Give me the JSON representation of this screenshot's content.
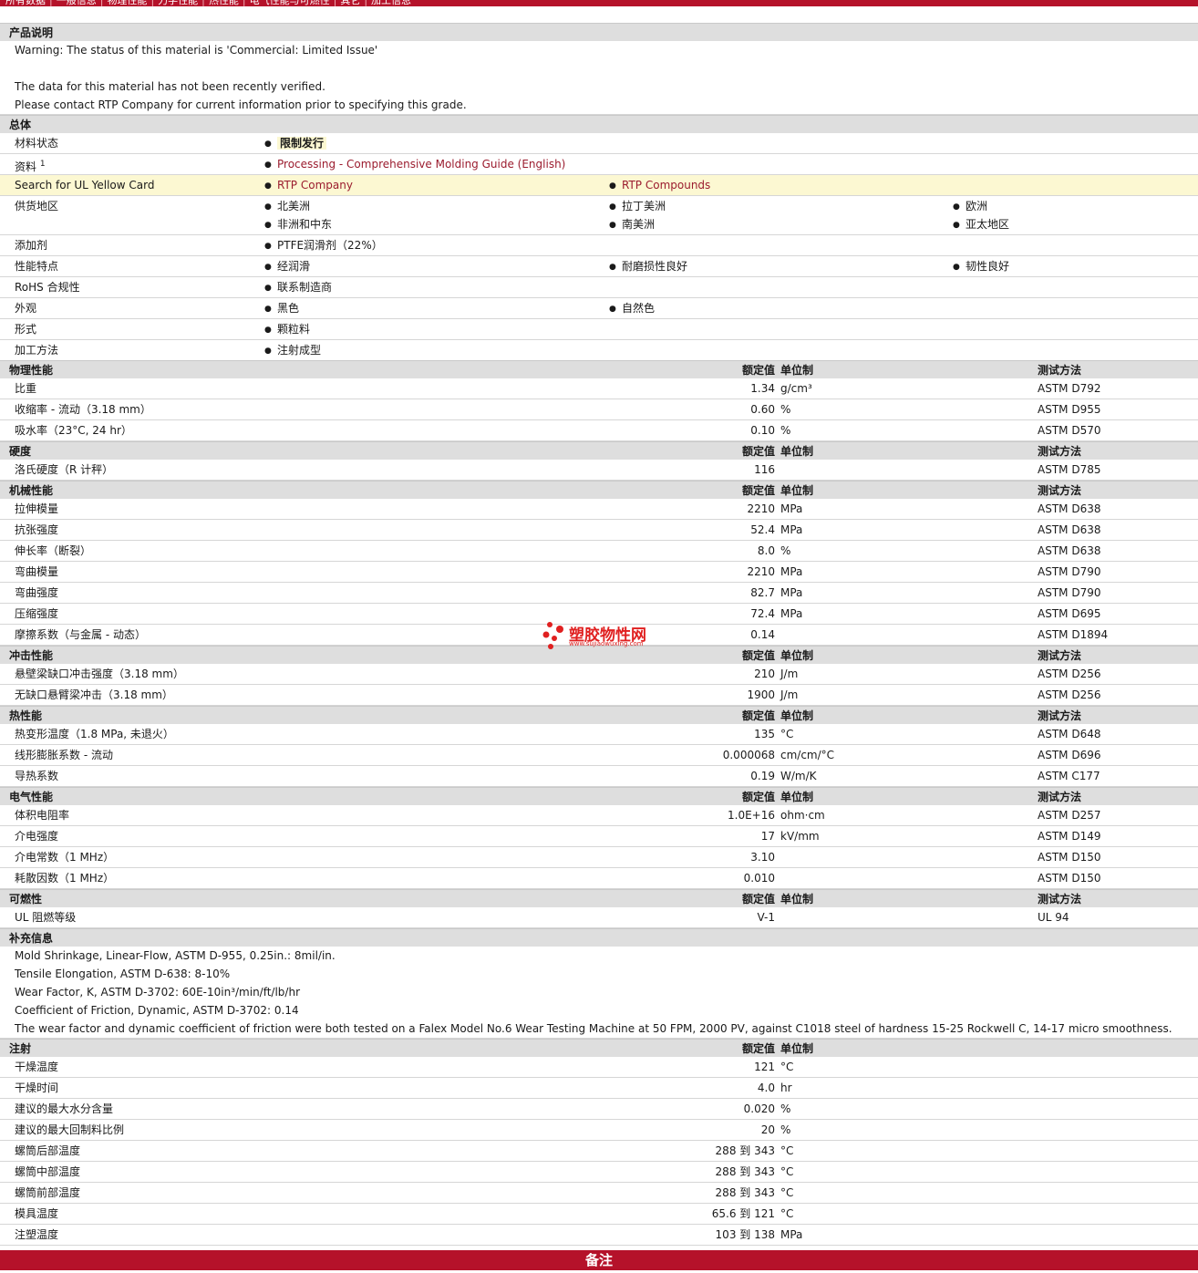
{
  "nav": [
    "所有数据",
    "一般信息",
    "物理性能",
    "力学性能",
    "热性能",
    "电气性能与可燃性",
    "其它",
    "加工信息"
  ],
  "desc": {
    "title": "产品说明",
    "lines": [
      "Warning: The status of this material is 'Commercial: Limited Issue'",
      "",
      "The data for this material has not been recently verified.",
      "Please contact RTP Company for current information prior to specifying this grade."
    ]
  },
  "general": {
    "title": "总体",
    "status_label": "材料状态",
    "status_value": "限制发行",
    "doc_label": "资料",
    "doc_sup": "1",
    "doc_link": "Processing - Comprehensive Molding Guide (English)",
    "ul_label": "Search for UL Yellow Card",
    "ul_link1": "RTP Company",
    "ul_link2": "RTP Compounds",
    "region_label": "供货地区",
    "regions": [
      "北美洲",
      "拉丁美洲",
      "欧洲",
      "非洲和中东",
      "南美洲",
      "亚太地区"
    ],
    "additive_label": "添加剂",
    "additive": "PTFE润滑剂（22%）",
    "feature_label": "性能特点",
    "features": [
      "经润滑",
      "耐磨损性良好",
      "韧性良好"
    ],
    "rohs_label": "RoHS 合规性",
    "rohs": "联系制造商",
    "look_label": "外观",
    "looks": [
      "黑色",
      "自然色"
    ],
    "form_label": "形式",
    "form": "颗粒料",
    "process_label": "加工方法",
    "process": "注射成型"
  },
  "hdr": {
    "value": "额定值",
    "unit": "单位制",
    "method": "测试方法"
  },
  "phys": {
    "title": "物理性能",
    "rows": [
      {
        "label": "比重",
        "value": "1.34",
        "unit": "g/cm³",
        "method": "ASTM D792"
      },
      {
        "label": "收缩率  - 流动（3.18 mm）",
        "value": "0.60",
        "unit": "%",
        "method": "ASTM D955"
      },
      {
        "label": "吸水率（23°C, 24 hr）",
        "value": "0.10",
        "unit": "%",
        "method": "ASTM D570"
      }
    ]
  },
  "hard": {
    "title": "硬度",
    "rows": [
      {
        "label": "洛氏硬度（R 计秤）",
        "value": "116",
        "unit": "",
        "method": "ASTM D785"
      }
    ]
  },
  "mech": {
    "title": "机械性能",
    "rows": [
      {
        "label": "拉伸模量",
        "value": "2210",
        "unit": "MPa",
        "method": "ASTM D638"
      },
      {
        "label": "抗张强度",
        "value": "52.4",
        "unit": "MPa",
        "method": "ASTM D638"
      },
      {
        "label": "伸长率（断裂）",
        "value": "8.0",
        "unit": "%",
        "method": "ASTM D638"
      },
      {
        "label": "弯曲模量",
        "value": "2210",
        "unit": "MPa",
        "method": "ASTM D790"
      },
      {
        "label": "弯曲强度",
        "value": "82.7",
        "unit": "MPa",
        "method": "ASTM D790"
      },
      {
        "label": "压缩强度",
        "value": "72.4",
        "unit": "MPa",
        "method": "ASTM D695"
      },
      {
        "label": "摩擦系数（与金属  - 动态）",
        "value": "0.14",
        "unit": "",
        "method": "ASTM D1894"
      }
    ]
  },
  "impact": {
    "title": "冲击性能",
    "rows": [
      {
        "label": "悬壁梁缺口冲击强度（3.18 mm）",
        "value": "210",
        "unit": "J/m",
        "method": "ASTM D256"
      },
      {
        "label": "无缺口悬臂梁冲击（3.18 mm）",
        "value": "1900",
        "unit": "J/m",
        "method": "ASTM D256"
      }
    ]
  },
  "thermal": {
    "title": "热性能",
    "rows": [
      {
        "label": "热变形温度（1.8 MPa, 未退火）",
        "value": "135",
        "unit": "°C",
        "method": "ASTM D648"
      },
      {
        "label": "线形膨胀系数  - 流动",
        "value": "0.000068",
        "unit": "cm/cm/°C",
        "method": "ASTM D696"
      },
      {
        "label": "导热系数",
        "value": "0.19",
        "unit": "W/m/K",
        "method": "ASTM C177"
      }
    ]
  },
  "elec": {
    "title": "电气性能",
    "rows": [
      {
        "label": "体积电阻率",
        "value": "1.0E+16",
        "unit": "ohm·cm",
        "method": "ASTM D257"
      },
      {
        "label": "介电强度",
        "value": "17",
        "unit": "kV/mm",
        "method": "ASTM D149"
      },
      {
        "label": "介电常数（1 MHz）",
        "value": "3.10",
        "unit": "",
        "method": "ASTM D150"
      },
      {
        "label": "耗散因数（1 MHz）",
        "value": "0.010",
        "unit": "",
        "method": "ASTM D150"
      }
    ]
  },
  "flam": {
    "title": "可燃性",
    "rows": [
      {
        "label": "UL 阻燃等级",
        "value": "V-1",
        "unit": "",
        "method": "UL 94"
      }
    ]
  },
  "extra": {
    "title": "补充信息",
    "lines": [
      "Mold Shrinkage, Linear-Flow, ASTM D-955, 0.25in.: 8mil/in.",
      "Tensile Elongation, ASTM D-638: 8-10%",
      "Wear Factor, K, ASTM D-3702: 60E-10in³/min/ft/lb/hr",
      "Coefficient of Friction, Dynamic, ASTM D-3702: 0.14",
      "The wear factor and dynamic coefficient of friction were both tested on a Falex Model No.6 Wear Testing Machine at 50 FPM, 2000 PV, against C1018 steel of hardness 15-25 Rockwell C, 14-17 micro smoothness."
    ]
  },
  "inject": {
    "title": "注射",
    "rows": [
      {
        "label": "干燥温度",
        "value": "121",
        "unit": "°C"
      },
      {
        "label": "干燥时间",
        "value": "4.0",
        "unit": "hr"
      },
      {
        "label": "建议的最大水分含量",
        "value": "0.020",
        "unit": "%"
      },
      {
        "label": "建议的最大回制料比例",
        "value": "20",
        "unit": "%"
      },
      {
        "label": "螺筒后部温度",
        "value": "288 到  343",
        "unit": "°C"
      },
      {
        "label": "螺筒中部温度",
        "value": "288 到  343",
        "unit": "°C"
      },
      {
        "label": "螺筒前部温度",
        "value": "288 到  343",
        "unit": "°C"
      },
      {
        "label": "模具温度",
        "value": "65.6 到  121",
        "unit": "°C"
      },
      {
        "label": "注塑温度",
        "value": "103 到  138",
        "unit": "MPa"
      }
    ]
  },
  "footer": "备注",
  "watermark": {
    "text": "塑胶物性网",
    "url": "www.sujiaowuxing.com"
  }
}
